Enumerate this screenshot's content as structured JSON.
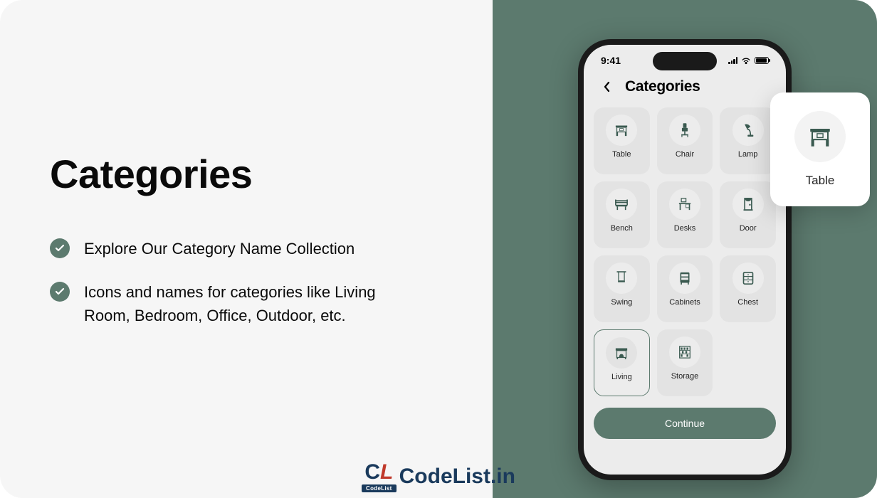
{
  "left": {
    "title": "Categories",
    "features": [
      "Explore Our Category Name Collection",
      "Icons and names for categories like Living Room, Bedroom, Office, Outdoor, etc."
    ]
  },
  "phone": {
    "time": "9:41",
    "header": "Categories",
    "continue": "Continue",
    "categories": [
      {
        "label": "Table",
        "icon": "table"
      },
      {
        "label": "Chair",
        "icon": "chair"
      },
      {
        "label": "Lamp",
        "icon": "lamp"
      },
      {
        "label": "Bench",
        "icon": "bench"
      },
      {
        "label": "Desks",
        "icon": "desks"
      },
      {
        "label": "Door",
        "icon": "door"
      },
      {
        "label": "Swing",
        "icon": "swing"
      },
      {
        "label": "Cabinets",
        "icon": "cabinets"
      },
      {
        "label": "Chest",
        "icon": "chest"
      },
      {
        "label": "Living",
        "icon": "living",
        "selected": true
      },
      {
        "label": "Storage",
        "icon": "storage"
      }
    ]
  },
  "popup": {
    "label": "Table",
    "icon": "table"
  },
  "watermark": {
    "brand": "CodeList.in",
    "sub": "CodeList"
  },
  "colors": {
    "accent": "#5c7a6e"
  }
}
